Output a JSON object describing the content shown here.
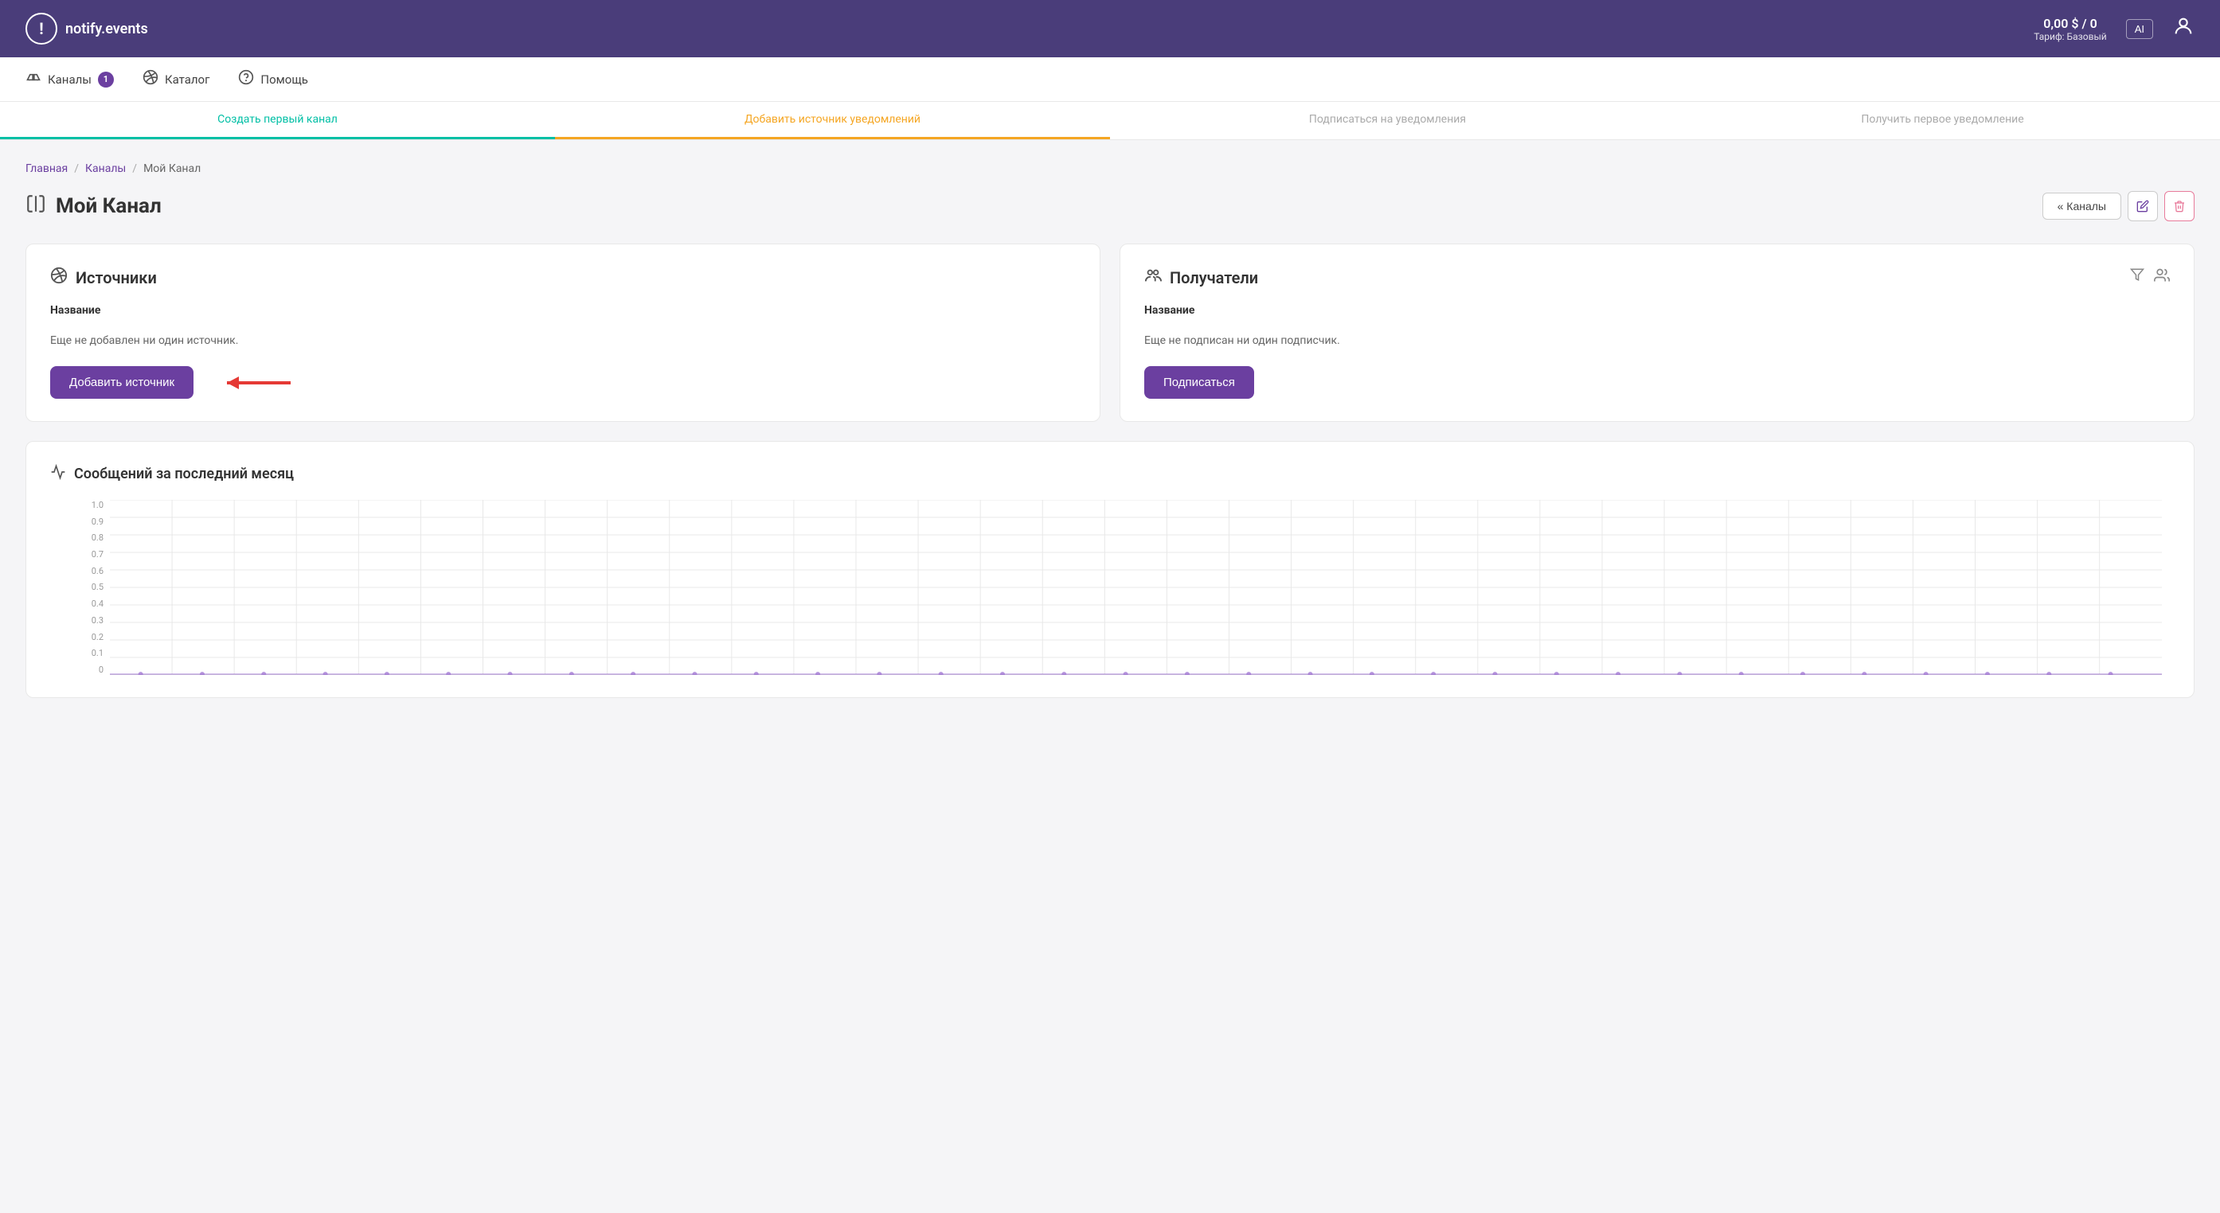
{
  "header": {
    "logo_text": "notify.events",
    "logo_icon": "!",
    "balance": "0,00 $ / 0",
    "tariff_label": "Тариф: Базовый",
    "ai_btn_label": "AI"
  },
  "nav": {
    "channels_label": "Каналы",
    "channels_badge": "1",
    "catalog_label": "Каталог",
    "help_label": "Помощь"
  },
  "progress_steps": [
    {
      "label": "Создать первый канал",
      "state": "active_green"
    },
    {
      "label": "Добавить источник уведомлений",
      "state": "active_yellow"
    },
    {
      "label": "Подписаться на уведомления",
      "state": "inactive"
    },
    {
      "label": "Получить первое уведомление",
      "state": "inactive"
    }
  ],
  "breadcrumb": {
    "home": "Главная",
    "channels": "Каналы",
    "current": "Мой Канал"
  },
  "page": {
    "title": "Мой Канал",
    "back_btn": "« Каналы"
  },
  "sources_card": {
    "title": "Источники",
    "column_header": "Название",
    "empty_msg": "Еще не добавлен ни один источник.",
    "add_btn": "Добавить источник"
  },
  "recipients_card": {
    "title": "Получатели",
    "column_header": "Название",
    "empty_msg": "Еще не подписан ни один подписчик.",
    "subscribe_btn": "Подписаться"
  },
  "chart": {
    "title": "Сообщений за последний месяц",
    "y_axis": [
      "1.0",
      "0.9",
      "0.8",
      "0.7",
      "0.6",
      "0.5",
      "0.4",
      "0.3",
      "0.2",
      "0.1",
      "0"
    ],
    "dots_count": 32
  }
}
